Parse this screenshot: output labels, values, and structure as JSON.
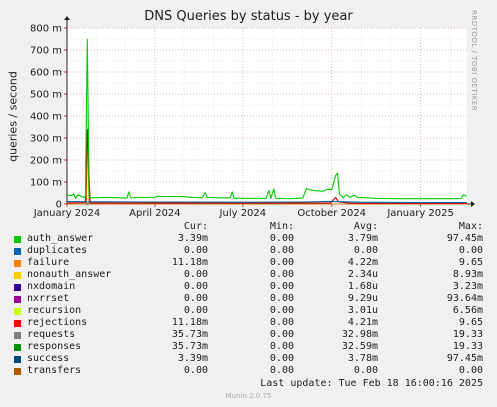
{
  "chart_data": {
    "type": "line",
    "title": "DNS Queries by status - by year",
    "ylabel": "queries / second",
    "ylim": [
      0,
      800
    ],
    "yticks": [
      {
        "value": 0,
        "label": "0"
      },
      {
        "value": 100,
        "label": "100 m"
      },
      {
        "value": 200,
        "label": "200 m"
      },
      {
        "value": 300,
        "label": "300 m"
      },
      {
        "value": 400,
        "label": "400 m"
      },
      {
        "value": 500,
        "label": "500 m"
      },
      {
        "value": 600,
        "label": "600 m"
      },
      {
        "value": 700,
        "label": "700 m"
      },
      {
        "value": 800,
        "label": "800 m"
      }
    ],
    "xrange": [
      "2024-01-01",
      "2025-02-18"
    ],
    "xticks": [
      {
        "value": "2024-01-01",
        "label": "January 2024"
      },
      {
        "value": "2024-04-01",
        "label": "April 2024"
      },
      {
        "value": "2024-07-01",
        "label": "July 2024"
      },
      {
        "value": "2024-10-01",
        "label": "October 2024"
      },
      {
        "value": "2025-01-01",
        "label": "January 2025"
      }
    ],
    "grid": true,
    "series": [
      {
        "name": "requests",
        "color": "#00CC00",
        "points": [
          [
            "2024-01-01",
            40
          ],
          [
            "2024-01-05",
            38
          ],
          [
            "2024-01-08",
            45
          ],
          [
            "2024-01-10",
            25
          ],
          [
            "2024-01-12",
            42
          ],
          [
            "2024-01-18",
            30
          ],
          [
            "2024-01-20",
            35
          ],
          [
            "2024-01-22",
            748
          ],
          [
            "2024-01-24",
            30
          ],
          [
            "2024-01-28",
            28
          ],
          [
            "2024-02-05",
            30
          ],
          [
            "2024-02-15",
            29
          ],
          [
            "2024-02-25",
            28
          ],
          [
            "2024-03-03",
            27
          ],
          [
            "2024-03-05",
            55
          ],
          [
            "2024-03-07",
            28
          ],
          [
            "2024-03-15",
            30
          ],
          [
            "2024-03-25",
            29
          ],
          [
            "2024-04-01",
            29
          ],
          [
            "2024-04-03",
            35
          ],
          [
            "2024-04-10",
            34
          ],
          [
            "2024-04-20",
            34
          ],
          [
            "2024-05-01",
            33
          ],
          [
            "2024-05-10",
            30
          ],
          [
            "2024-05-20",
            28
          ],
          [
            "2024-05-23",
            52
          ],
          [
            "2024-05-25",
            30
          ],
          [
            "2024-06-05",
            28
          ],
          [
            "2024-06-18",
            28
          ],
          [
            "2024-06-20",
            55
          ],
          [
            "2024-06-22",
            26
          ],
          [
            "2024-07-01",
            26
          ],
          [
            "2024-07-10",
            26
          ],
          [
            "2024-07-25",
            25
          ],
          [
            "2024-07-28",
            62
          ],
          [
            "2024-07-30",
            26
          ],
          [
            "2024-08-02",
            68
          ],
          [
            "2024-08-04",
            26
          ],
          [
            "2024-08-20",
            24
          ],
          [
            "2024-09-01",
            27
          ],
          [
            "2024-09-05",
            70
          ],
          [
            "2024-09-08",
            65
          ],
          [
            "2024-09-15",
            60
          ],
          [
            "2024-09-22",
            58
          ],
          [
            "2024-09-26",
            66
          ],
          [
            "2024-10-01",
            65
          ],
          [
            "2024-10-05",
            130
          ],
          [
            "2024-10-07",
            140
          ],
          [
            "2024-10-09",
            45
          ],
          [
            "2024-10-13",
            28
          ],
          [
            "2024-10-16",
            42
          ],
          [
            "2024-10-20",
            30
          ],
          [
            "2024-10-24",
            40
          ],
          [
            "2024-10-28",
            30
          ],
          [
            "2024-11-05",
            28
          ],
          [
            "2024-11-20",
            25
          ],
          [
            "2024-12-10",
            24
          ],
          [
            "2024-12-31",
            24
          ],
          [
            "2025-01-15",
            24
          ],
          [
            "2025-01-31",
            24
          ],
          [
            "2025-02-05",
            24
          ],
          [
            "2025-02-12",
            25
          ],
          [
            "2025-02-14",
            42
          ],
          [
            "2025-02-18",
            36
          ]
        ]
      },
      {
        "name": "success",
        "color": "#0066B3",
        "points": [
          [
            "2024-01-01",
            12
          ],
          [
            "2024-01-20",
            10
          ],
          [
            "2024-02-15",
            10
          ],
          [
            "2024-04-01",
            9
          ],
          [
            "2024-07-01",
            8
          ],
          [
            "2024-09-01",
            9
          ],
          [
            "2024-10-01",
            12
          ],
          [
            "2024-11-01",
            8
          ],
          [
            "2025-01-01",
            7
          ],
          [
            "2025-02-18",
            7
          ]
        ]
      },
      {
        "name": "rejections",
        "color": "#CC0000",
        "points": [
          [
            "2024-01-01",
            5
          ],
          [
            "2024-01-20",
            6
          ],
          [
            "2024-01-22",
            340
          ],
          [
            "2024-01-25",
            4
          ],
          [
            "2024-05-01",
            4
          ],
          [
            "2024-07-01",
            4
          ],
          [
            "2024-09-30",
            5
          ],
          [
            "2024-10-05",
            30
          ],
          [
            "2024-10-08",
            10
          ],
          [
            "2024-10-20",
            3
          ],
          [
            "2025-02-18",
            3
          ]
        ]
      },
      {
        "name": "transfers",
        "color": "#CC7700",
        "points": [
          [
            "2024-01-01",
            0
          ],
          [
            "2024-01-21",
            0
          ],
          [
            "2024-01-22",
            330
          ],
          [
            "2024-01-24",
            0
          ],
          [
            "2025-02-18",
            0
          ]
        ]
      }
    ],
    "legend": {
      "headers": {
        "cur": "Cur:",
        "min": "Min:",
        "avg": "Avg:",
        "max": "Max:"
      },
      "rows": [
        {
          "name": "auth_answer",
          "color": "#00CC00",
          "cur": "3.39m",
          "min": "0.00",
          "avg": "3.79m",
          "max": "97.45m"
        },
        {
          "name": "duplicates",
          "color": "#0066B3",
          "cur": "0.00",
          "min": "0.00",
          "avg": "0.00",
          "max": "0.00"
        },
        {
          "name": "failure",
          "color": "#FF8000",
          "cur": "11.18m",
          "min": "0.00",
          "avg": "4.22m",
          "max": "9.65"
        },
        {
          "name": "nonauth_answer",
          "color": "#FFCC00",
          "cur": "0.00",
          "min": "0.00",
          "avg": "2.34u",
          "max": "8.93m"
        },
        {
          "name": "nxdomain",
          "color": "#330099",
          "cur": "0.00",
          "min": "0.00",
          "avg": "1.68u",
          "max": "3.23m"
        },
        {
          "name": "nxrrset",
          "color": "#990099",
          "cur": "0.00",
          "min": "0.00",
          "avg": "9.29u",
          "max": "93.64m"
        },
        {
          "name": "recursion",
          "color": "#CCFF00",
          "cur": "0.00",
          "min": "0.00",
          "avg": "3.01u",
          "max": "6.56m"
        },
        {
          "name": "rejections",
          "color": "#FF0000",
          "cur": "11.18m",
          "min": "0.00",
          "avg": "4.21m",
          "max": "9.65"
        },
        {
          "name": "requests",
          "color": "#808080",
          "cur": "35.73m",
          "min": "0.00",
          "avg": "32.98m",
          "max": "19.33"
        },
        {
          "name": "responses",
          "color": "#008F00",
          "cur": "35.73m",
          "min": "0.00",
          "avg": "32.59m",
          "max": "19.33"
        },
        {
          "name": "success",
          "color": "#00487D",
          "cur": "3.39m",
          "min": "0.00",
          "avg": "3.78m",
          "max": "97.45m"
        },
        {
          "name": "transfers",
          "color": "#B35A00",
          "cur": "0.00",
          "min": "0.00",
          "avg": "0.00",
          "max": "0.00"
        }
      ]
    },
    "last_update": "Last update: Tue Feb 18 16:00:16 2025",
    "watermark": "RRDTOOL / TOBI OETIKER",
    "footer": "Munin 2.0.75"
  }
}
